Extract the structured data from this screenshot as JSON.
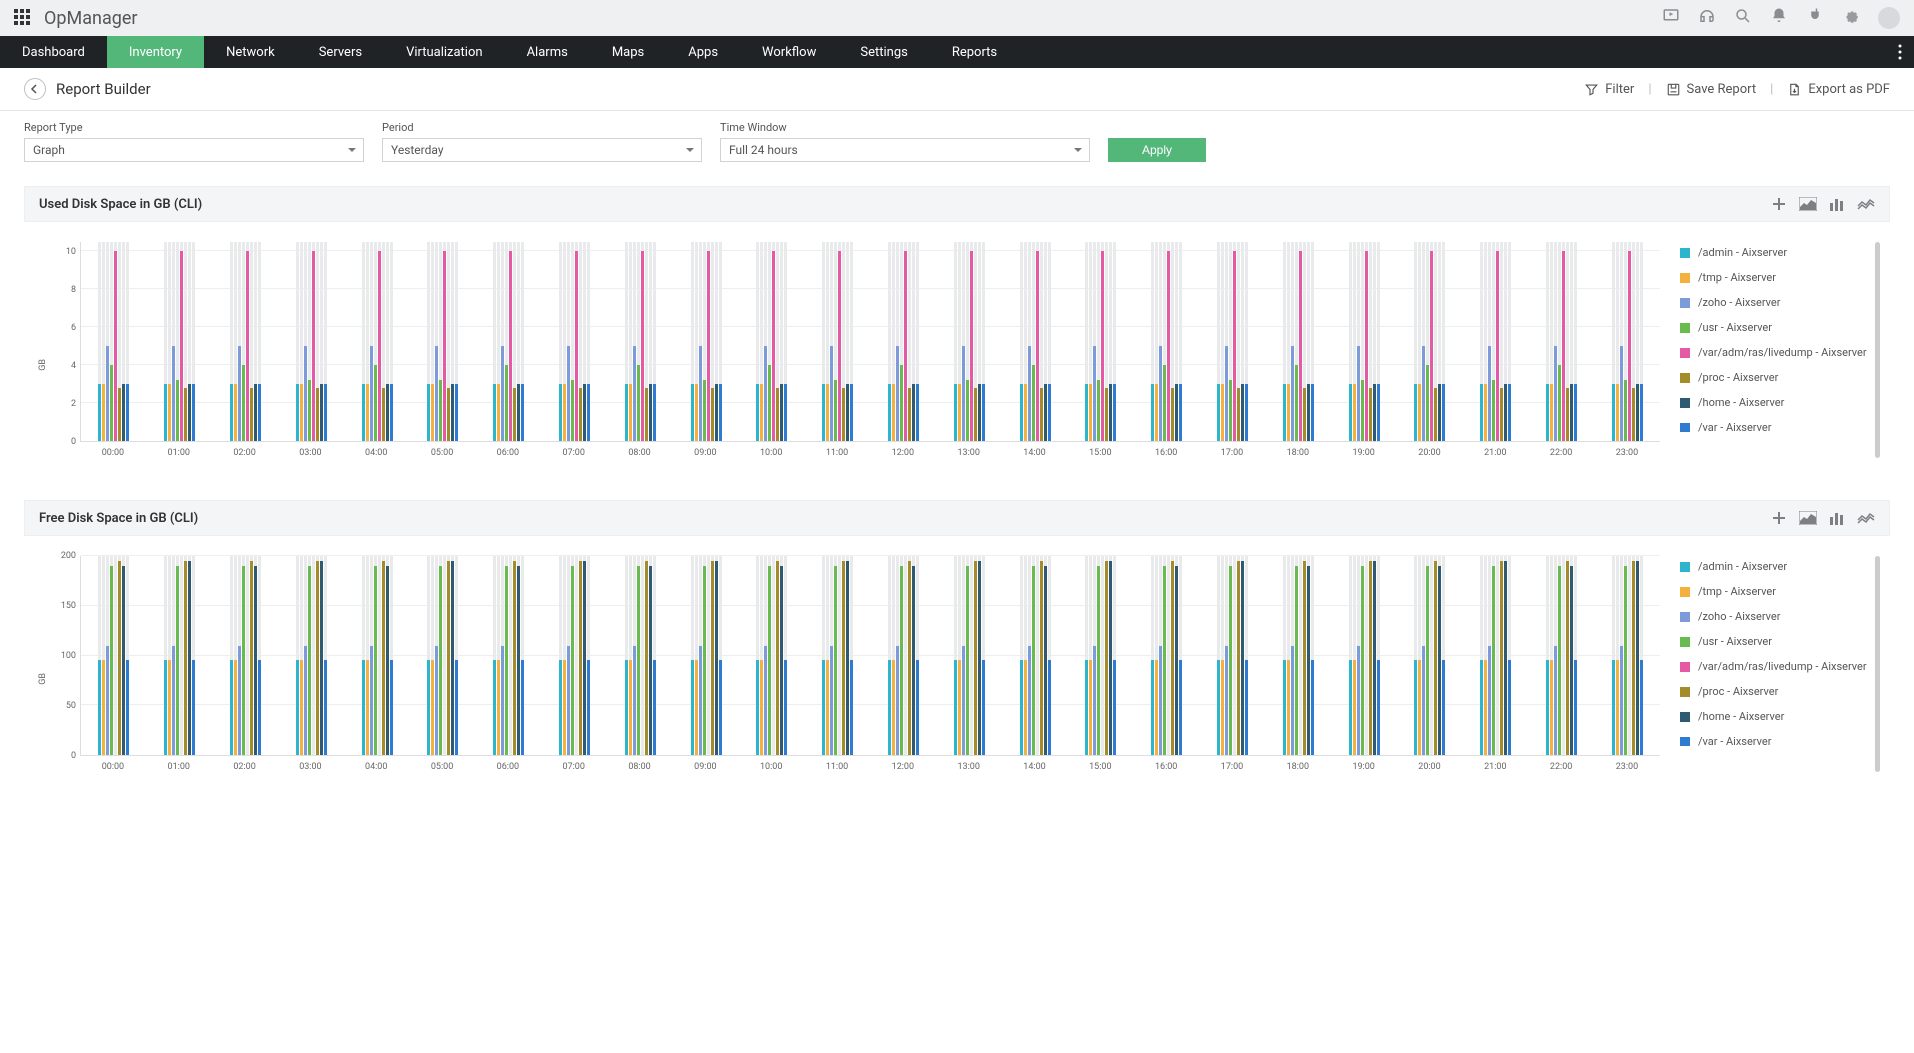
{
  "brand": "OpManager",
  "nav": [
    {
      "label": "Dashboard",
      "active": false
    },
    {
      "label": "Inventory",
      "active": true
    },
    {
      "label": "Network",
      "active": false
    },
    {
      "label": "Servers",
      "active": false
    },
    {
      "label": "Virtualization",
      "active": false
    },
    {
      "label": "Alarms",
      "active": false
    },
    {
      "label": "Maps",
      "active": false
    },
    {
      "label": "Apps",
      "active": false
    },
    {
      "label": "Workflow",
      "active": false
    },
    {
      "label": "Settings",
      "active": false
    },
    {
      "label": "Reports",
      "active": false
    }
  ],
  "page_title": "Report Builder",
  "toolbar_actions": {
    "filter": "Filter",
    "save": "Save Report",
    "export": "Export as PDF"
  },
  "filters": {
    "report_type": {
      "label": "Report Type",
      "value": "Graph"
    },
    "period": {
      "label": "Period",
      "value": "Yesterday"
    },
    "time_window": {
      "label": "Time Window",
      "value": "Full 24 hours"
    },
    "apply": "Apply"
  },
  "series_colors": {
    "admin": "#2cb5cc",
    "tmp": "#f3b23e",
    "zoho": "#7e9bd9",
    "usr": "#6abb4f",
    "livedump": "#e55aa4",
    "proc": "#a58c2b",
    "home": "#2e5a73",
    "var": "#2f7bd1"
  },
  "series_labels": {
    "admin": "/admin - Aixserver",
    "tmp": "/tmp - Aixserver",
    "zoho": "/zoho - Aixserver",
    "usr": "/usr - Aixserver",
    "livedump": "/var/adm/ras/livedump - Aixserver",
    "proc": "/proc - Aixserver",
    "home": "/home - Aixserver",
    "var": "/var - Aixserver"
  },
  "chart_data": [
    {
      "id": "used",
      "title": "Used Disk Space in GB (CLI)",
      "type": "bar",
      "ylabel": "GB",
      "ylim": [
        0,
        10.5
      ],
      "yticks": [
        0,
        2,
        4,
        6,
        8,
        10
      ],
      "categories": [
        "00:00",
        "01:00",
        "02:00",
        "03:00",
        "04:00",
        "05:00",
        "06:00",
        "07:00",
        "08:00",
        "09:00",
        "10:00",
        "11:00",
        "12:00",
        "13:00",
        "14:00",
        "15:00",
        "16:00",
        "17:00",
        "18:00",
        "19:00",
        "20:00",
        "21:00",
        "22:00",
        "23:00"
      ],
      "bar_bg": 10.5,
      "series": [
        {
          "key": "admin",
          "values": [
            3.0,
            3.0,
            3.0,
            3.0,
            3.0,
            3.0,
            3.0,
            3.0,
            3.0,
            3.0,
            3.0,
            3.0,
            3.0,
            3.0,
            3.0,
            3.0,
            3.0,
            3.0,
            3.0,
            3.0,
            3.0,
            3.0,
            3.0,
            3.0
          ]
        },
        {
          "key": "tmp",
          "values": [
            3.0,
            3.0,
            3.0,
            3.0,
            3.0,
            3.0,
            3.0,
            3.0,
            3.0,
            3.0,
            3.0,
            3.0,
            3.0,
            3.0,
            3.0,
            3.0,
            3.0,
            3.0,
            3.0,
            3.0,
            3.0,
            3.0,
            3.0,
            3.0
          ]
        },
        {
          "key": "zoho",
          "values": [
            5.0,
            5.0,
            5.0,
            5.0,
            5.0,
            5.0,
            5.0,
            5.0,
            5.0,
            5.0,
            5.0,
            5.0,
            5.0,
            5.0,
            5.0,
            5.0,
            5.0,
            5.0,
            5.0,
            5.0,
            5.0,
            5.0,
            5.0,
            5.0
          ]
        },
        {
          "key": "usr",
          "values": [
            4.0,
            3.2,
            4.0,
            3.2,
            4.0,
            3.2,
            4.0,
            3.2,
            4.0,
            3.2,
            4.0,
            3.2,
            4.0,
            3.2,
            4.0,
            3.2,
            4.0,
            3.2,
            4.0,
            3.2,
            4.0,
            3.2,
            4.0,
            3.2
          ]
        },
        {
          "key": "livedump",
          "values": [
            10.0,
            10.0,
            10.0,
            10.0,
            10.0,
            10.0,
            10.0,
            10.0,
            10.0,
            10.0,
            10.0,
            10.0,
            10.0,
            10.0,
            10.0,
            10.0,
            10.0,
            10.0,
            10.0,
            10.0,
            10.0,
            10.0,
            10.0,
            10.0
          ]
        },
        {
          "key": "proc",
          "values": [
            2.8,
            2.8,
            2.8,
            2.8,
            2.8,
            2.8,
            2.8,
            2.8,
            2.8,
            2.8,
            2.8,
            2.8,
            2.8,
            2.8,
            2.8,
            2.8,
            2.8,
            2.8,
            2.8,
            2.8,
            2.8,
            2.8,
            2.8,
            2.8
          ]
        },
        {
          "key": "home",
          "values": [
            3.0,
            3.0,
            3.0,
            3.0,
            3.0,
            3.0,
            3.0,
            3.0,
            3.0,
            3.0,
            3.0,
            3.0,
            3.0,
            3.0,
            3.0,
            3.0,
            3.0,
            3.0,
            3.0,
            3.0,
            3.0,
            3.0,
            3.0,
            3.0
          ]
        },
        {
          "key": "var",
          "values": [
            3.0,
            3.0,
            3.0,
            3.0,
            3.0,
            3.0,
            3.0,
            3.0,
            3.0,
            3.0,
            3.0,
            3.0,
            3.0,
            3.0,
            3.0,
            3.0,
            3.0,
            3.0,
            3.0,
            3.0,
            3.0,
            3.0,
            3.0,
            3.0
          ]
        }
      ]
    },
    {
      "id": "free",
      "title": "Free Disk Space in GB (CLI)",
      "type": "bar",
      "ylabel": "GB",
      "ylim": [
        0,
        200
      ],
      "yticks": [
        0,
        50,
        100,
        150,
        200
      ],
      "categories": [
        "00:00",
        "01:00",
        "02:00",
        "03:00",
        "04:00",
        "05:00",
        "06:00",
        "07:00",
        "08:00",
        "09:00",
        "10:00",
        "11:00",
        "12:00",
        "13:00",
        "14:00",
        "15:00",
        "16:00",
        "17:00",
        "18:00",
        "19:00",
        "20:00",
        "21:00",
        "22:00",
        "23:00"
      ],
      "bar_bg": 200,
      "series": [
        {
          "key": "admin",
          "values": [
            95,
            95,
            95,
            95,
            95,
            95,
            95,
            95,
            95,
            95,
            95,
            95,
            95,
            95,
            95,
            95,
            95,
            95,
            95,
            95,
            95,
            95,
            95,
            95
          ]
        },
        {
          "key": "tmp",
          "values": [
            95,
            95,
            95,
            95,
            95,
            95,
            95,
            95,
            95,
            95,
            95,
            95,
            95,
            95,
            95,
            95,
            95,
            95,
            95,
            95,
            95,
            95,
            95,
            95
          ]
        },
        {
          "key": "zoho",
          "values": [
            110,
            110,
            110,
            110,
            110,
            110,
            110,
            110,
            110,
            110,
            110,
            110,
            110,
            110,
            110,
            110,
            110,
            110,
            110,
            110,
            110,
            110,
            110,
            110
          ]
        },
        {
          "key": "usr",
          "values": [
            190,
            190,
            190,
            190,
            190,
            190,
            190,
            190,
            190,
            190,
            190,
            190,
            190,
            190,
            190,
            190,
            190,
            190,
            190,
            190,
            190,
            190,
            190,
            190
          ]
        },
        {
          "key": "livedump",
          "values": [
            0,
            0,
            0,
            0,
            0,
            0,
            0,
            0,
            0,
            0,
            0,
            0,
            0,
            0,
            0,
            0,
            0,
            0,
            0,
            0,
            0,
            0,
            0,
            0
          ]
        },
        {
          "key": "proc",
          "values": [
            195,
            195,
            195,
            195,
            195,
            195,
            195,
            195,
            195,
            195,
            195,
            195,
            195,
            195,
            195,
            195,
            195,
            195,
            195,
            195,
            195,
            195,
            195,
            195
          ]
        },
        {
          "key": "home",
          "values": [
            190,
            195,
            190,
            195,
            190,
            195,
            190,
            195,
            190,
            195,
            190,
            195,
            190,
            195,
            190,
            195,
            190,
            195,
            190,
            195,
            190,
            195,
            190,
            195
          ]
        },
        {
          "key": "var",
          "values": [
            95,
            95,
            95,
            95,
            95,
            95,
            95,
            95,
            95,
            95,
            95,
            95,
            95,
            95,
            95,
            95,
            95,
            95,
            95,
            95,
            95,
            95,
            95,
            95
          ]
        }
      ]
    }
  ]
}
